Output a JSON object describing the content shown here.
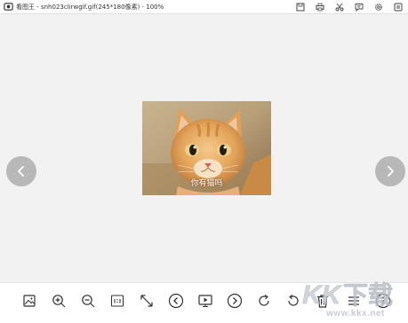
{
  "window": {
    "title": "看图王 - snh023clirwgif.gif(245*180像素) - 100%",
    "actions": [
      {
        "name": "save-icon"
      },
      {
        "name": "print-icon"
      },
      {
        "name": "cut-icon"
      },
      {
        "name": "message-icon"
      },
      {
        "name": "settings-icon"
      },
      {
        "name": "app-menu-icon"
      }
    ]
  },
  "viewer": {
    "image_caption": "你有猫吗",
    "zoom": "100%",
    "image_size": "245*180"
  },
  "toolbar": {
    "tools": [
      "image-gallery-icon",
      "zoom-in-icon",
      "zoom-out-icon",
      "actual-size-icon",
      "fit-window-icon",
      "previous-image-icon",
      "slideshow-icon",
      "next-image-icon",
      "rotate-right-icon",
      "rotate-left-icon",
      "delete-icon",
      "menu-icon",
      "info-icon"
    ]
  },
  "watermark": {
    "logo_text": "KK下载",
    "url": "www.kkx.net"
  },
  "colors": {
    "background": "#f2f2f2",
    "nav_button": "#b8b8b8",
    "watermark": "#c9cdd3"
  }
}
